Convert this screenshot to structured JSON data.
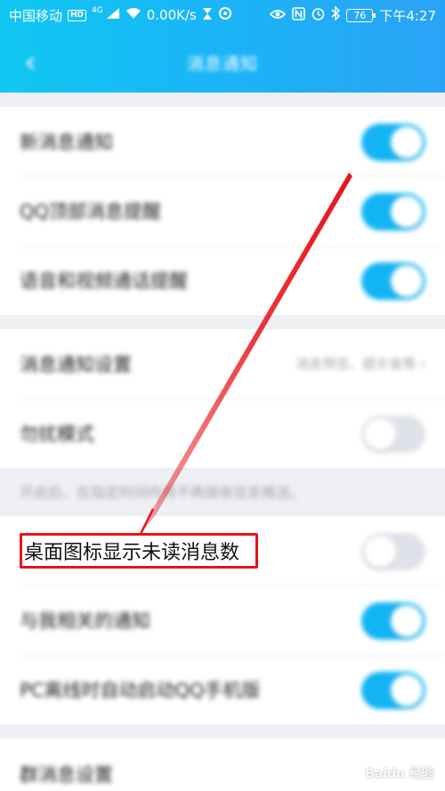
{
  "status_bar": {
    "carrier": "中国移动",
    "hd_badge": "HD",
    "signal_type": "4G",
    "net_speed": "0.00K/s",
    "battery": "76",
    "time": "下午4:27",
    "icons": [
      "signal-icon",
      "wifi-icon",
      "hourglass-icon",
      "eye-icon",
      "nfc-icon",
      "alarm-icon",
      "bluetooth-icon",
      "battery-icon"
    ]
  },
  "title_bar": {
    "back_glyph": "‹",
    "title": "消息通知"
  },
  "groups": {
    "basic": [
      {
        "label": "新消息通知",
        "on": true
      },
      {
        "label": "QQ顶部消息提醒",
        "on": true
      },
      {
        "label": "语音和视频通话提醒",
        "on": true
      }
    ],
    "settings": {
      "notify_settings_label": "消息通知设置",
      "notify_settings_detail": "消息预览、提示音等",
      "chevron": "›",
      "dnd_label": "勿扰模式",
      "dnd_on": false
    },
    "dnd_note": "开启后，在指定时间内将不再接收信息推送。",
    "desktop": {
      "badge_label": "桌面图标显示未读消息数",
      "badge_on": false,
      "related_label": "与我相关的通知",
      "related_on": true,
      "pc_offline_label": "PC离线时自动启动QQ手机版",
      "pc_offline_on": true
    },
    "group_msg_label": "群消息设置"
  },
  "watermark": "Baidu 经验",
  "colors": {
    "toggle_on": "#13b4f4",
    "toggle_off": "#dfe2e8",
    "header_gradient_start": "#11c7f2",
    "header_gradient_end": "#2aa3f6",
    "annotation_red": "#e8131a"
  }
}
